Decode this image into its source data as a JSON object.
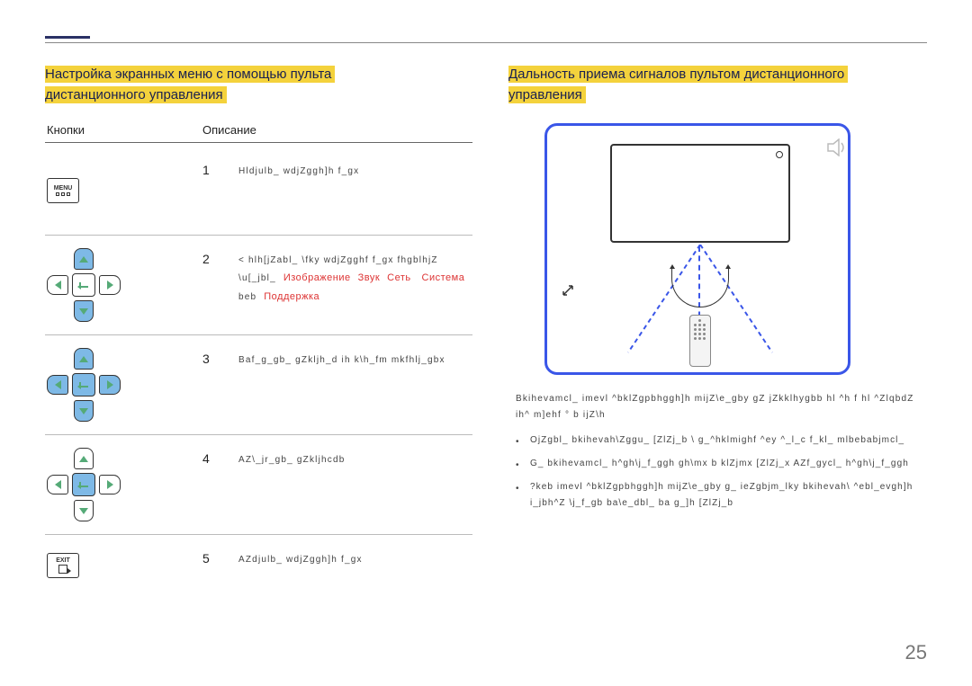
{
  "left": {
    "heading_l1": "Настройка экранных меню с помощью пульта",
    "heading_l2": "дистанционного управления",
    "col1": "Кнопки",
    "col2": "Описание",
    "rows": [
      {
        "n": "1",
        "button_label": "MENU",
        "desc": "Hldjulb_ wdjZggh]h f_gx"
      },
      {
        "n": "2",
        "desc_a": "< hlh[jZabl_ \\fky wdjZgghf f_gx fhgblhjZ",
        "desc_b": "\\u[_jbl_",
        "red_1": "Изображение",
        "red_2": "Звук",
        "red_3": "Сеть",
        "red_4": "Система",
        "desc_c": "beb",
        "red_5": "Поддержка"
      },
      {
        "n": "3",
        "desc": "Baf_g_gb_ gZkljh_d ih k\\h_fm mkfhlj_gbx"
      },
      {
        "n": "4",
        "desc": "AZ\\_jr_gb_ gZkljhcdb"
      },
      {
        "n": "5",
        "button_label": "EXIT",
        "desc": "AZdjulb_ wdjZggh]h f_gx"
      }
    ]
  },
  "right": {
    "heading_l1": "Дальность приема сигналов пультом дистанционного",
    "heading_l2": "управления",
    "para_1": "Bkihevamcl_ imevl ^bklZgpbhggh]h mijZ\\e_gby gZ jZkklhygbb hl  ^h  f hl ^ZlqbdZ ih^ m]ehf  ° b ijZ\\h",
    "bullets": [
      "OjZgbl_ bkihevah\\Zggu_ [ZlZj_b \\ g_^hklmighf ^ey ^_l_c f_kl_ mlbebabjmcl_",
      "G_ bkihevamcl_ h^gh\\j_f_ggh gh\\mx b klZjmx [ZlZj_x AZf_gycl_ h^gh\\j_f_ggh",
      "?keb imevl ^bklZgpbhggh]h mijZ\\e_gby g_ ieZgbjm_lky bkihevah\\ ^ebl_evgh]h i_jbh^Z \\j_f_gb ba\\e_dbl_ ba g_]h [ZlZj_b"
    ]
  },
  "page": "25"
}
